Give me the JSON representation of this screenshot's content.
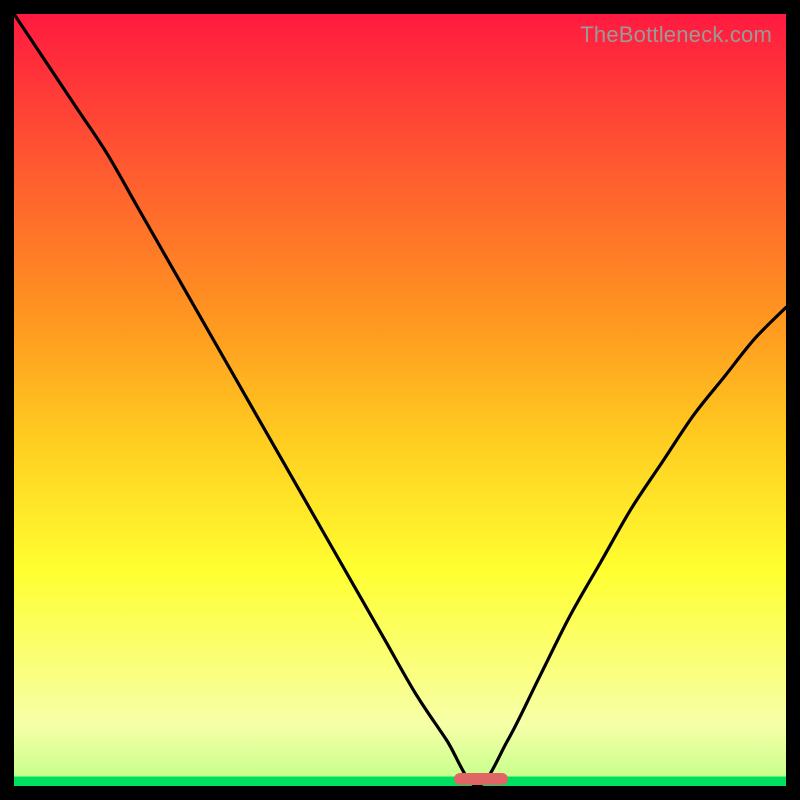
{
  "attribution": "TheBottleneck.com",
  "colors": {
    "frame": "#000000",
    "gradient_top": "#ff1a40",
    "gradient_mid": "#ffff30",
    "gradient_low": "#f7ffa8",
    "gradient_bottom": "#00e060",
    "curve": "#000000",
    "marker": "#e06666",
    "attribution_text": "#9a9a9a"
  },
  "chart_data": {
    "type": "line",
    "title": "",
    "xlabel": "",
    "ylabel": "",
    "xlim": [
      0,
      100
    ],
    "ylim": [
      0,
      100
    ],
    "x": [
      0,
      4,
      8,
      12,
      16,
      20,
      24,
      28,
      32,
      36,
      40,
      44,
      48,
      52,
      56,
      60,
      64,
      68,
      72,
      76,
      80,
      84,
      88,
      92,
      96,
      100
    ],
    "y": [
      100,
      94,
      88,
      82,
      75,
      68,
      61,
      54,
      47,
      40,
      33,
      26,
      19,
      12,
      6,
      0,
      6,
      14,
      22,
      29,
      36,
      42,
      48,
      53,
      58,
      62
    ],
    "minimum_x": 60,
    "marker": {
      "x_start": 57,
      "x_end": 64,
      "y": 0
    },
    "legend": false,
    "grid": false
  }
}
